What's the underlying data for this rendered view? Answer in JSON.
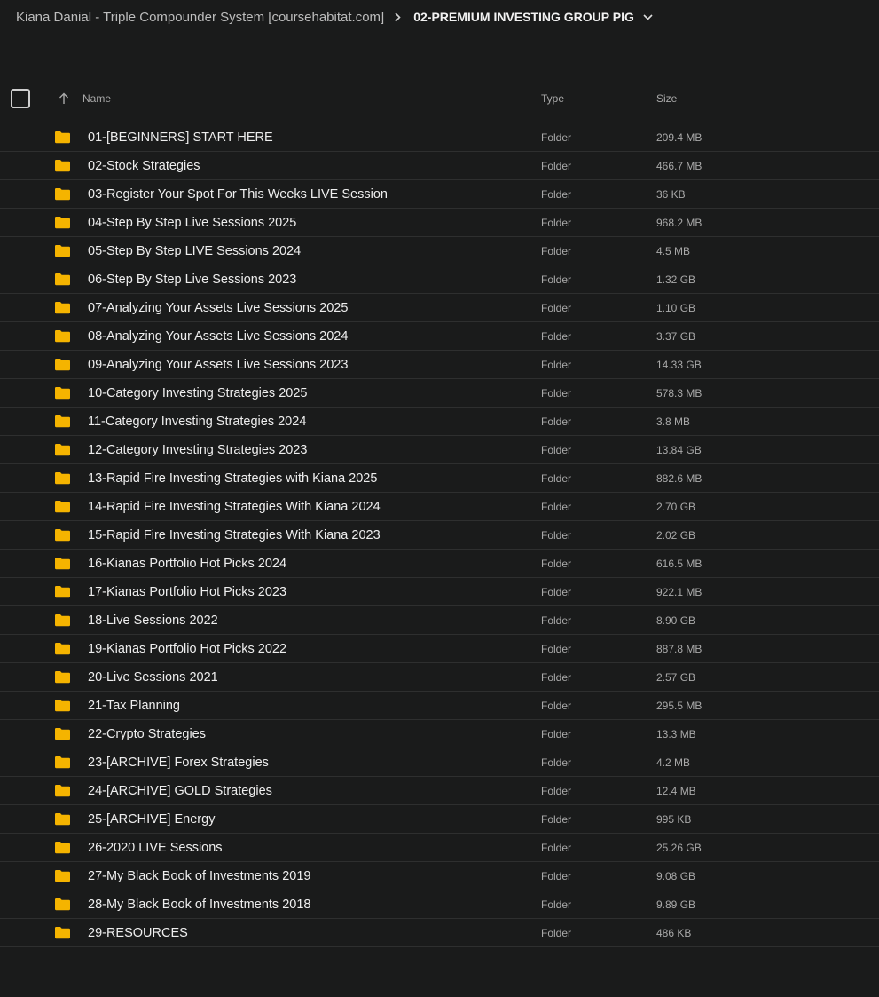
{
  "breadcrumb": {
    "parent": "Kiana Danial - Triple Compounder System [coursehabitat.com]",
    "separator_icon": "chevron-right-icon",
    "current": "02-PREMIUM INVESTING GROUP PIG",
    "dropdown_icon": "chevron-down-icon"
  },
  "table": {
    "columns": {
      "name": "Name",
      "type": "Type",
      "size": "Size"
    },
    "sort_icon": "arrow-up-icon",
    "folder_color": "#f5b400",
    "rows": [
      {
        "name": "01-[BEGINNERS] START HERE",
        "type": "Folder",
        "size": "209.4 MB"
      },
      {
        "name": "02-Stock Strategies",
        "type": "Folder",
        "size": "466.7 MB"
      },
      {
        "name": "03-Register Your Spot For This Weeks LIVE Session",
        "type": "Folder",
        "size": "36 KB"
      },
      {
        "name": "04-Step By Step Live Sessions 2025",
        "type": "Folder",
        "size": "968.2 MB"
      },
      {
        "name": "05-Step By Step LIVE Sessions 2024",
        "type": "Folder",
        "size": "4.5 MB"
      },
      {
        "name": "06-Step By Step Live Sessions 2023",
        "type": "Folder",
        "size": "1.32 GB"
      },
      {
        "name": "07-Analyzing Your Assets Live Sessions 2025",
        "type": "Folder",
        "size": "1.10 GB"
      },
      {
        "name": "08-Analyzing Your Assets Live Sessions 2024",
        "type": "Folder",
        "size": "3.37 GB"
      },
      {
        "name": "09-Analyzing Your Assets Live Sessions 2023",
        "type": "Folder",
        "size": "14.33 GB"
      },
      {
        "name": "10-Category Investing Strategies 2025",
        "type": "Folder",
        "size": "578.3 MB"
      },
      {
        "name": "11-Category Investing Strategies 2024",
        "type": "Folder",
        "size": "3.8 MB"
      },
      {
        "name": "12-Category Investing Strategies 2023",
        "type": "Folder",
        "size": "13.84 GB"
      },
      {
        "name": "13-Rapid Fire Investing Strategies with Kiana 2025",
        "type": "Folder",
        "size": "882.6 MB"
      },
      {
        "name": "14-Rapid Fire Investing Strategies With Kiana 2024",
        "type": "Folder",
        "size": "2.70 GB"
      },
      {
        "name": "15-Rapid Fire Investing Strategies With Kiana 2023",
        "type": "Folder",
        "size": "2.02 GB"
      },
      {
        "name": "16-Kianas Portfolio Hot Picks 2024",
        "type": "Folder",
        "size": "616.5 MB"
      },
      {
        "name": "17-Kianas Portfolio Hot Picks 2023",
        "type": "Folder",
        "size": "922.1 MB"
      },
      {
        "name": "18-Live Sessions 2022",
        "type": "Folder",
        "size": "8.90 GB"
      },
      {
        "name": "19-Kianas Portfolio Hot Picks 2022",
        "type": "Folder",
        "size": "887.8 MB"
      },
      {
        "name": "20-Live Sessions 2021",
        "type": "Folder",
        "size": "2.57 GB"
      },
      {
        "name": "21-Tax Planning",
        "type": "Folder",
        "size": "295.5 MB"
      },
      {
        "name": "22-Crypto Strategies",
        "type": "Folder",
        "size": "13.3 MB"
      },
      {
        "name": "23-[ARCHIVE] Forex Strategies",
        "type": "Folder",
        "size": "4.2 MB"
      },
      {
        "name": "24-[ARCHIVE] GOLD Strategies",
        "type": "Folder",
        "size": "12.4 MB"
      },
      {
        "name": "25-[ARCHIVE] Energy",
        "type": "Folder",
        "size": "995 KB"
      },
      {
        "name": "26-2020 LIVE Sessions",
        "type": "Folder",
        "size": "25.26 GB"
      },
      {
        "name": "27-My Black Book of Investments 2019",
        "type": "Folder",
        "size": "9.08 GB"
      },
      {
        "name": "28-My Black Book of Investments 2018",
        "type": "Folder",
        "size": "9.89 GB"
      },
      {
        "name": "29-RESOURCES",
        "type": "Folder",
        "size": "486 KB"
      }
    ]
  }
}
